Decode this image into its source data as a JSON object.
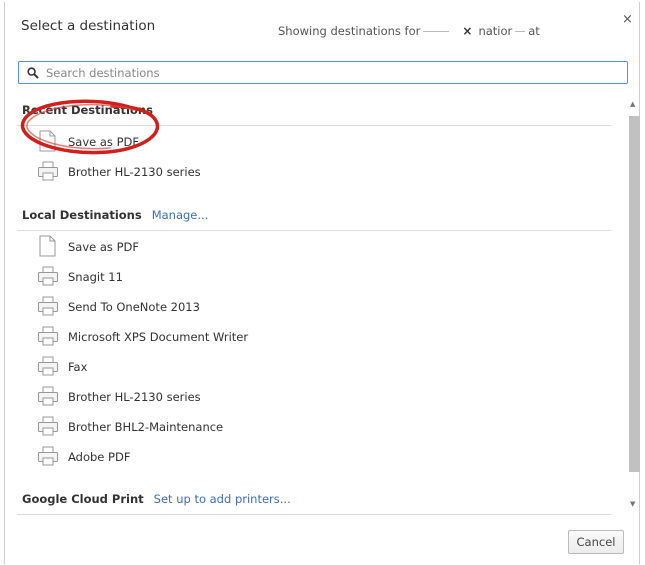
{
  "dialog": {
    "title": "Select a destination",
    "showing_text": "Showing destinations for",
    "showing_tail": "natior",
    "showing_tail2": "at",
    "showing_x": "×",
    "close_glyph": "×"
  },
  "search": {
    "placeholder": "Search destinations",
    "value": ""
  },
  "recent": {
    "heading": "Recent Destinations",
    "items": [
      {
        "label": "Save as PDF",
        "icon": "document-icon"
      },
      {
        "label": "Brother HL-2130 series",
        "icon": "printer-icon"
      }
    ]
  },
  "local": {
    "heading": "Local Destinations",
    "link": "Manage...",
    "items": [
      {
        "label": "Save as PDF",
        "icon": "document-icon"
      },
      {
        "label": "Snagit 11",
        "icon": "printer-icon"
      },
      {
        "label": "Send To OneNote 2013",
        "icon": "printer-icon"
      },
      {
        "label": "Microsoft XPS Document Writer",
        "icon": "printer-icon"
      },
      {
        "label": "Fax",
        "icon": "printer-icon"
      },
      {
        "label": "Brother HL-2130 series",
        "icon": "printer-icon"
      },
      {
        "label": "Brother BHL2-Maintenance",
        "icon": "printer-icon"
      },
      {
        "label": "Adobe PDF",
        "icon": "printer-icon"
      }
    ]
  },
  "cloud": {
    "heading": "Google Cloud Print",
    "link": "Set up to add printers..."
  },
  "footer": {
    "cancel_label": "Cancel"
  },
  "colors": {
    "accent": "#4d90fe",
    "link": "#3b6cc4",
    "annotation": "#d0201d"
  }
}
